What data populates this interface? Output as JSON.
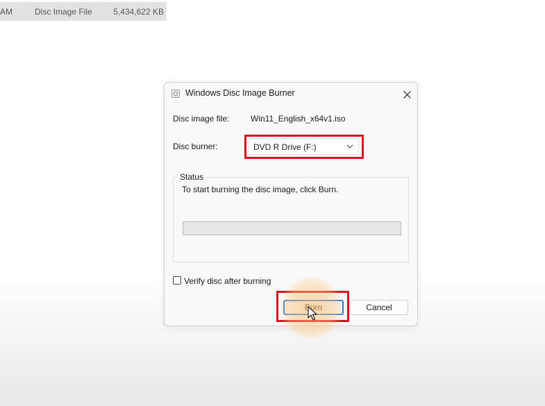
{
  "background_file": {
    "time_fragment": "AM",
    "type": "Disc Image File",
    "size": "5,434,622 KB"
  },
  "dialog": {
    "title": "Windows Disc Image Burner",
    "title_icon": "disc-burner-icon",
    "close_icon": "close-icon",
    "disc_image_label": "Disc image file:",
    "disc_image_value": "Win11_English_x64v1.iso",
    "disc_burner_label": "Disc burner:",
    "disc_burner_value": "DVD R Drive (F:)",
    "status_label": "Status",
    "status_text": "To start burning the disc image, click Burn.",
    "progress_fraction": 0,
    "verify_label": "Verify disc after burning",
    "verify_checked": false,
    "burn_label": "Burn",
    "cancel_label": "Cancel"
  },
  "annotation_color": "#d7131d",
  "accent_color": "#2b7cd3"
}
